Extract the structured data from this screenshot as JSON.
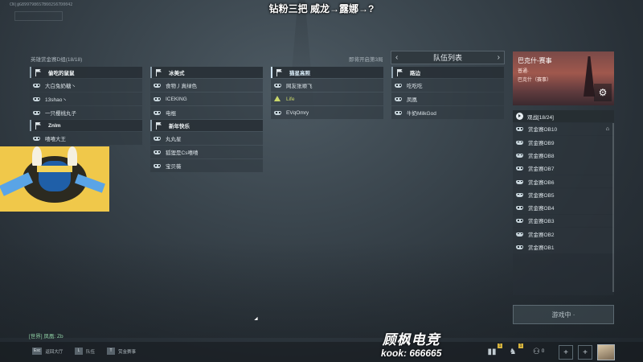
{
  "watermark": "CN|@G8997986S7B602S67D0042",
  "caption": "钻粉三把 威龙→露娜→?",
  "lobby": {
    "title": "英雄赏金赛D组(18/18)",
    "next_round": "即将开启第3局"
  },
  "team_list": {
    "title": "队伍列表"
  },
  "squads": [
    {
      "name": "偷吃的鼠鼠",
      "members": [
        {
          "name": "大白兔奶糖丶"
        },
        {
          "name": "13shao丶"
        },
        {
          "name": "一只樱桃丸子"
        }
      ]
    },
    {
      "name": "冰美式",
      "members": [
        {
          "name": "食物丿真绿色"
        },
        {
          "name": "ICEKING"
        },
        {
          "name": "电棍"
        }
      ]
    },
    {
      "name": "猫星高照",
      "active": true,
      "members": [
        {
          "name": "网友张顺飞"
        },
        {
          "name": "Life",
          "warn": true
        },
        {
          "name": "EVqOmry"
        }
      ]
    },
    {
      "name": "路边",
      "members": [
        {
          "name": "吃吃吃"
        },
        {
          "name": "凤凰"
        },
        {
          "name": "牛奶MilkGod"
        }
      ]
    },
    {
      "name": "Znlm",
      "members": [
        {
          "name": "嘻嘻大王"
        }
      ]
    },
    {
      "name": "新年快乐",
      "members": [
        {
          "name": "丸丸星"
        },
        {
          "name": "狐狸是Cs嘻嘻"
        },
        {
          "name": "宝贝薇"
        }
      ]
    }
  ],
  "map_card": {
    "title": "巴克什-赛事",
    "line2": "普通·",
    "line3": "巴克什（赛事）"
  },
  "observers": {
    "title": "观战[18/24]",
    "items": [
      "赏金赛OB10",
      "赏金赛OB9",
      "赏金赛OB8",
      "赏金赛OB7",
      "赏金赛OB6",
      "赏金赛OB5",
      "赏金赛OB4",
      "赏金赛OB3",
      "赏金赛OB2",
      "赏金赛OB1"
    ]
  },
  "in_game_button": "游戏中 ·",
  "chat": "[世界] 凤凰: Zb",
  "keys": [
    {
      "key": "Esc",
      "label": "返回大厅"
    },
    {
      "key": "L",
      "label": "队伍"
    },
    {
      "key": "T",
      "label": "赏金赛事"
    }
  ],
  "brand": {
    "line1": "顾枫电竞",
    "line2": "kook: 666665"
  },
  "badges": {
    "chart": "1",
    "horse": "0"
  }
}
